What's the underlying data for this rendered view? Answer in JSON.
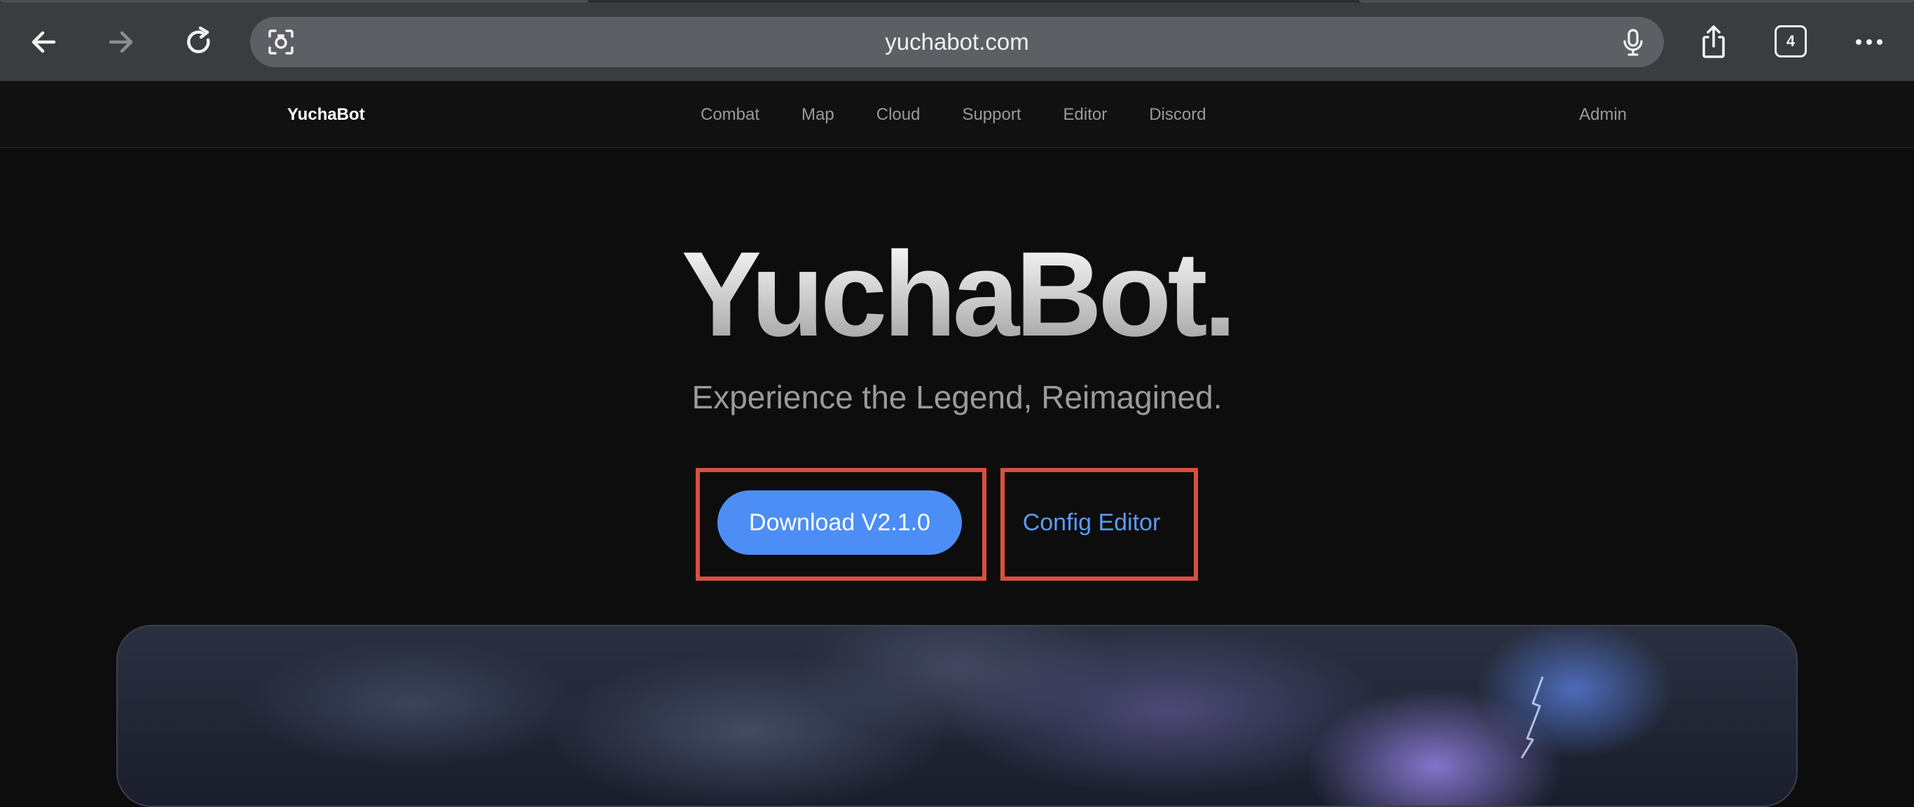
{
  "browser": {
    "url": "yuchabot.com",
    "tab_count": "4",
    "icons": {
      "back": "arrow-left-icon",
      "forward": "arrow-right-icon",
      "reload": "reload-icon",
      "lens": "camera-lens-icon",
      "mic": "microphone-icon",
      "share": "share-icon",
      "more": "more-dots-icon"
    }
  },
  "header": {
    "brand": "YuchaBot",
    "nav": [
      "Combat",
      "Map",
      "Cloud",
      "Support",
      "Editor",
      "Discord"
    ],
    "admin": "Admin"
  },
  "hero": {
    "title": "YuchaBot.",
    "subtitle": "Experience the Legend, Reimagined.",
    "download_label": "Download V2.1.0",
    "config_label": "Config Editor"
  },
  "colors": {
    "accent": "#4c8ef5",
    "link": "#5b9bf5",
    "highlight": "#d9503d",
    "background": "#0d0d0d"
  }
}
